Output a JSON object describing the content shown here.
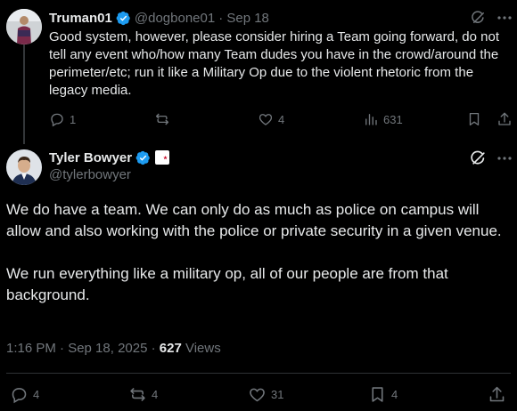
{
  "parent": {
    "name": "Truman01",
    "handle": "@dogbone01",
    "date": "· Sep 18",
    "text": "Good system, however, please consider hiring a Team going forward, do not tell any event who/how many Team dudes you have in the crowd/around the perimeter/etc; run it like a Military Op due to the violent rhetoric from the legacy media.",
    "replies": "1",
    "reposts": "",
    "likes": "4",
    "views": "631"
  },
  "main": {
    "name": "Tyler Bowyer",
    "handle": "@tylerbowyer",
    "paragraph1": "We do have a team. We can only do as much as police on campus will allow and also working with the police or private security in a given venue.",
    "paragraph2": "We run everything like a military op, all of our people are from that background.",
    "timestamp": "1:16 PM · Sep 18, 2025 · ",
    "views_count": "627",
    "views_label": " Views",
    "replies": "4",
    "reposts": "4",
    "likes": "31",
    "bookmarks": "4"
  },
  "colors": {
    "background": "#000000",
    "text": "#e7e9ea",
    "muted": "#71767b",
    "verified": "#1d9bf0",
    "divider": "#2f3336"
  },
  "icons": [
    "verified-badge-icon",
    "grok-icon",
    "more-icon",
    "reply-icon",
    "repost-icon",
    "like-icon",
    "views-icon",
    "bookmark-icon",
    "share-icon",
    "affiliate-badge-icon"
  ]
}
